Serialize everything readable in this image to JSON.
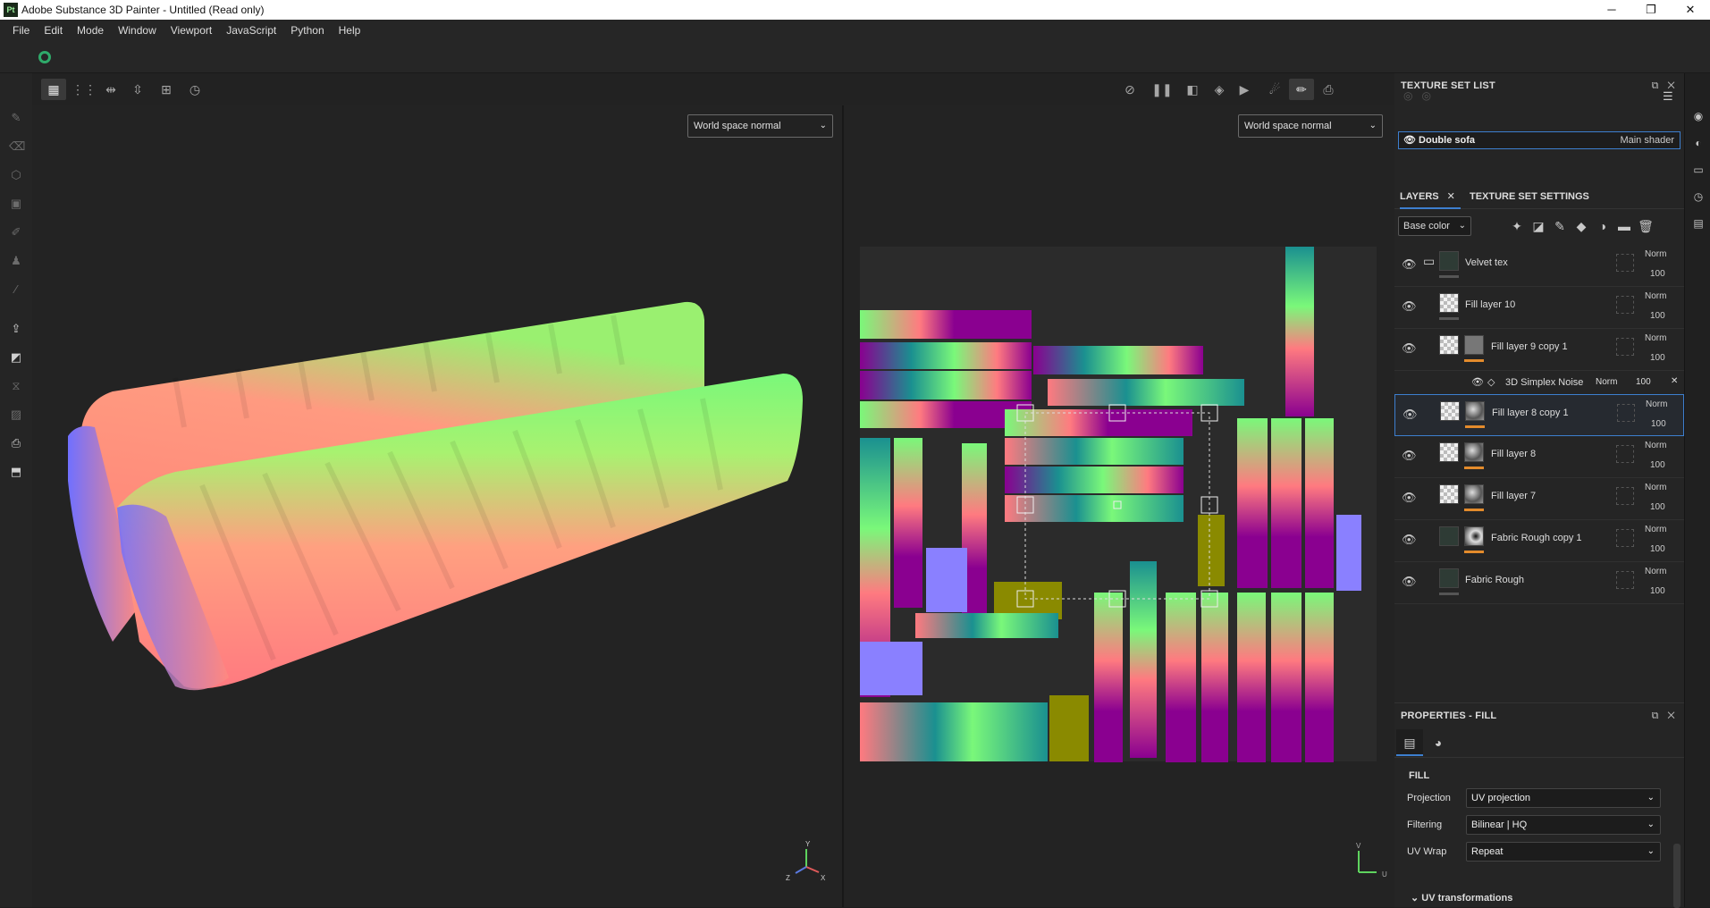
{
  "window": {
    "title": "Adobe Substance 3D Painter - Untitled (Read only)",
    "logo": "Pt",
    "minimize": "─",
    "maximize": "❐",
    "close": "✕"
  },
  "menu": [
    "File",
    "Edit",
    "Mode",
    "Window",
    "Viewport",
    "JavaScript",
    "Python",
    "Help"
  ],
  "viewport": {
    "left_mode": "World space normal",
    "right_mode": "World space normal",
    "axis_y": "Y",
    "axis_x": "X",
    "axis_z": "Z",
    "uv_u": "U",
    "uv_v": "V"
  },
  "texture_set_list": {
    "title": "TEXTURE SET LIST",
    "set_name": "Double sofa",
    "shader": "Main shader"
  },
  "layers_panel": {
    "tab_layers": "LAYERS",
    "tab_settings": "TEXTURE SET SETTINGS",
    "channel": "Base color",
    "layers": [
      {
        "name": "Velvet tex",
        "blend": "Norm",
        "opacity": "100"
      },
      {
        "name": "Fill layer 10",
        "blend": "Norm",
        "opacity": "100"
      },
      {
        "name": "Fill layer 9 copy 1",
        "blend": "Norm",
        "opacity": "100"
      },
      {
        "name": "Fill layer 8 copy 1",
        "blend": "Norm",
        "opacity": "100"
      },
      {
        "name": "Fill layer 8",
        "blend": "Norm",
        "opacity": "100"
      },
      {
        "name": "Fill layer 7",
        "blend": "Norm",
        "opacity": "100"
      },
      {
        "name": "Fabric Rough copy 1",
        "blend": "Norm",
        "opacity": "100"
      },
      {
        "name": "Fabric Rough",
        "blend": "Norm",
        "opacity": "100"
      }
    ],
    "effect": {
      "name": "3D Simplex Noise",
      "blend": "Norm",
      "opacity": "100"
    }
  },
  "properties": {
    "title": "PROPERTIES - FILL",
    "section": "FILL",
    "projection_label": "Projection",
    "projection": "UV projection",
    "filtering_label": "Filtering",
    "filtering": "Bilinear | HQ",
    "uvwrap_label": "UV Wrap",
    "uvwrap": "Repeat",
    "uv_transform": "UV transformations"
  }
}
